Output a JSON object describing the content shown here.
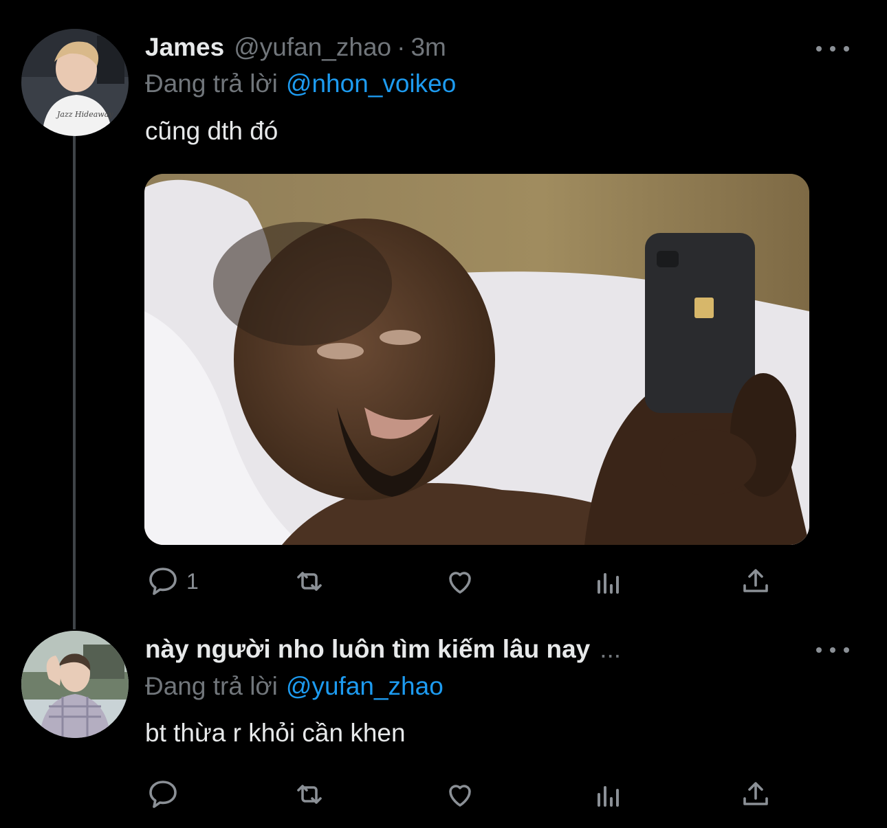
{
  "tweets": [
    {
      "author": {
        "display_name": "James",
        "handle": "@yufan_zhao",
        "avatar_icon": "user-avatar-photo"
      },
      "separator": "·",
      "time": "3m",
      "replying_to_label": "Đang trả lời",
      "replying_to_handle": "@nhon_voikeo",
      "text": "cũng dth đó",
      "has_media": true,
      "media_description_icon": "photo-man-in-bed-with-phone",
      "actions": {
        "reply_count": "1",
        "retweet_count": "",
        "like_count": "",
        "views_count": ""
      }
    },
    {
      "author": {
        "display_name": "này người nho luôn tìm kiếm lâu nay",
        "truncation": "...",
        "avatar_icon": "user-avatar-photo"
      },
      "replying_to_label": "Đang trả lời",
      "replying_to_handle": "@yufan_zhao",
      "text": "bt thừa r khỏi cần khen",
      "has_media": false,
      "actions": {
        "reply_count": "",
        "retweet_count": "",
        "like_count": "",
        "views_count": ""
      }
    }
  ],
  "colors": {
    "background": "#000000",
    "primary_text": "#e7e9ea",
    "secondary_text": "#71767b",
    "link": "#1d9bf0",
    "thread_line": "#3f4448"
  }
}
